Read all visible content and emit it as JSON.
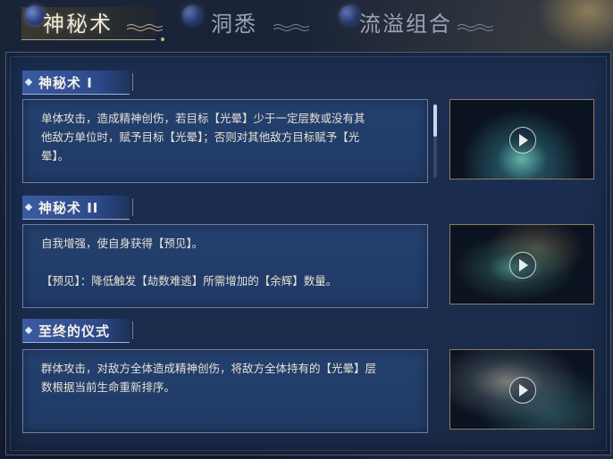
{
  "tabs": [
    {
      "label": "神秘术",
      "active": true
    },
    {
      "label": "洞悉",
      "active": false
    },
    {
      "label": "流溢组合",
      "active": false
    }
  ],
  "skills": [
    {
      "title": "神秘术 I",
      "description": "单体攻击，造成精神创伤，若目标【光晕】少于一定层数或没有其\n他敌方单位时，赋予目标【光晕】；否则对其他敌方目标赋予【光\n晕】。",
      "video_icon": "play-icon"
    },
    {
      "title": "神秘术 II",
      "description": "自我增强，使自身获得【预见】。\n\n【预见】：降低触发【劫数难逃】所需增加的【余辉】数量。",
      "video_icon": "play-icon"
    },
    {
      "title": "至终的仪式",
      "description": "群体攻击，对敌方全体造成精神创伤，将敌方全体持有的【光晕】层\n数根据当前生命重新排序。",
      "video_icon": "play-icon"
    }
  ],
  "colors": {
    "header_blue": "#3c5aa0",
    "panel_bg": "#1c3054",
    "text": "#e6e1d3",
    "frame_gold": "#8b7d5c"
  }
}
